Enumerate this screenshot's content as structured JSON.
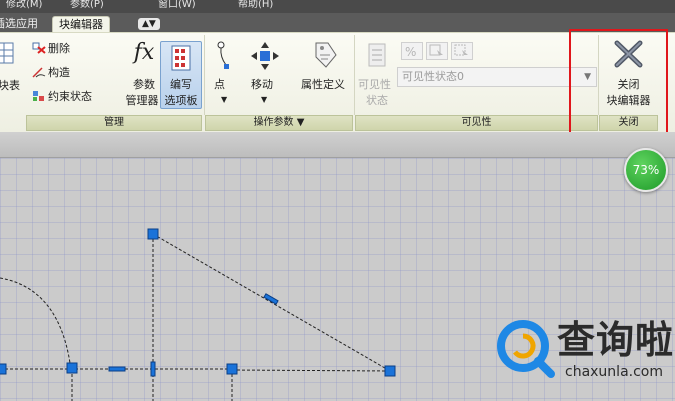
{
  "menu": {
    "items": [
      "修改(M)",
      "参数(P)",
      "窗口(W)",
      "帮助(H)"
    ]
  },
  "tabs": {
    "partial_left": "插选应用",
    "active": "块编辑器",
    "extra": "▲▼"
  },
  "ribbon": {
    "manage": {
      "partial_button_label": "块表",
      "items": [
        "删除",
        "构造",
        "约束状态"
      ],
      "param_manager_label_1": "参数",
      "param_manager_label_2": "管理器",
      "write_palette_label_1": "编写",
      "write_palette_label_2": "选项板",
      "group_label": "管理"
    },
    "operation": {
      "point_label": "点",
      "move_label": "移动",
      "attribute_label": "属性定义",
      "group_label": "操作参数 ▼"
    },
    "visibility": {
      "visibility_state_label_1": "可见性",
      "visibility_state_label_2": "状态",
      "dropdown_value": "可见性状态0",
      "group_label": "可见性"
    },
    "close": {
      "close_label_1": "关闭",
      "close_label_2": "块编辑器",
      "group_label": "关闭"
    }
  },
  "zoom_badge": "73%",
  "watermark": {
    "title": "查询啦",
    "subtitle": "chaxunla.com"
  },
  "colors": {
    "ribbon_bg": "#f4f5ea",
    "group_bar": "#d6dbb6",
    "highlight_box": "#e0161b",
    "canvas_bg": "#cbcbcb",
    "grip_blue": "#1a73d9",
    "zoom_green": "#2aae34",
    "logo_blue": "#1e88e5"
  }
}
